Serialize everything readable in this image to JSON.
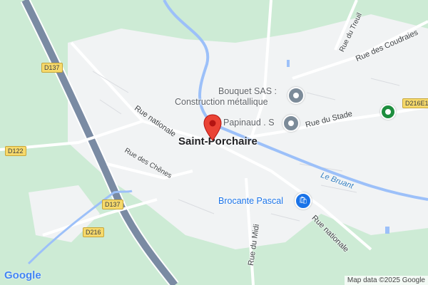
{
  "map": {
    "place": "Saint-Porchaire",
    "streets": {
      "rue_nationale_nw": "Rue nationale",
      "rue_nationale_se": "Rue nationale",
      "rue_des_chenes": "Rue des Chênes",
      "rue_du_stade": "Rue du Stade",
      "rue_du_midi": "Rue du Midi",
      "rue_du_treuil": "Rue du Treuil",
      "rue_des_coudraies": "Rue des Coudraies"
    },
    "water": {
      "le_bruant": "Le Bruant"
    },
    "roads": {
      "d137_top": "D137",
      "d137_bottom": "D137",
      "d122": "D122",
      "d216": "D216",
      "d216e1": "D216E1"
    },
    "pois": {
      "bouquet_line1": "Bouquet SAS :",
      "bouquet_line2": "Construction métallique",
      "papinaud": "Papinaud . S",
      "brocante": "Brocante Pascal"
    },
    "logo": "Google",
    "attribution": "Map data ©2025 Google"
  },
  "colors": {
    "land": "#f1f3f4",
    "green": "#cdebd5",
    "water": "#9cc0f9",
    "highway": "#7a8ba3",
    "pin": "#ea4335",
    "poi_blue": "#1a73e8",
    "poi_green": "#1e8e3e"
  }
}
